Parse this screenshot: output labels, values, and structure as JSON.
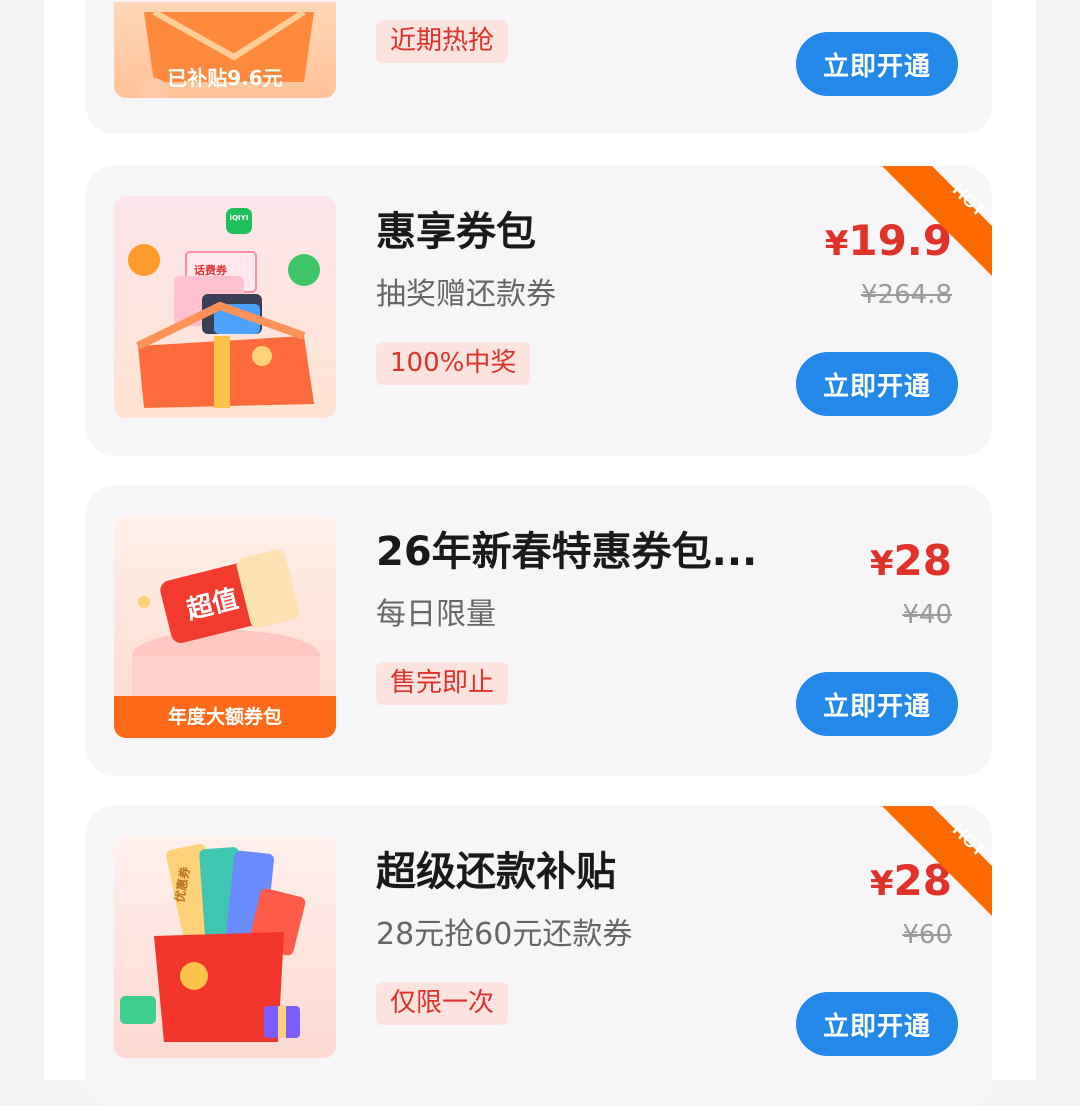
{
  "cards": [
    {
      "thumb_banner": "已补贴9.6元",
      "tag": "近期热抢",
      "button": "立即开通"
    },
    {
      "title": "惠享券包",
      "subtitle": "抽奖赠还款券",
      "tag": "100%中奖",
      "currency": "¥",
      "price": "19.9",
      "original_price": "¥264.8",
      "button": "立即开通",
      "badge": "HOT",
      "thumb_labels": [
        "iQIYI",
        "话费券"
      ]
    },
    {
      "title": "26年新春特惠券包...",
      "subtitle": "每日限量",
      "tag": "售完即止",
      "currency": "¥",
      "price": "28",
      "original_price": "¥40",
      "button": "立即开通",
      "thumb_banner": "年度大额券包",
      "thumb_sticker": "超值"
    },
    {
      "title": "超级还款补贴",
      "subtitle": "28元抢60元还款券",
      "tag": "仅限一次",
      "currency": "¥",
      "price": "28",
      "original_price": "¥60",
      "button": "立即开通",
      "badge": "HOT",
      "thumb_labels": [
        "优惠券"
      ]
    }
  ],
  "colors": {
    "accent_red": "#e0322b",
    "button_blue": "#2488e8",
    "hot_badge": "#ff6a00",
    "banner_orange": "#ff6a1a"
  },
  "icons": [
    "gift-box-image",
    "coupon-pack-image",
    "red-envelope-image",
    "hot-corner-badge"
  ]
}
